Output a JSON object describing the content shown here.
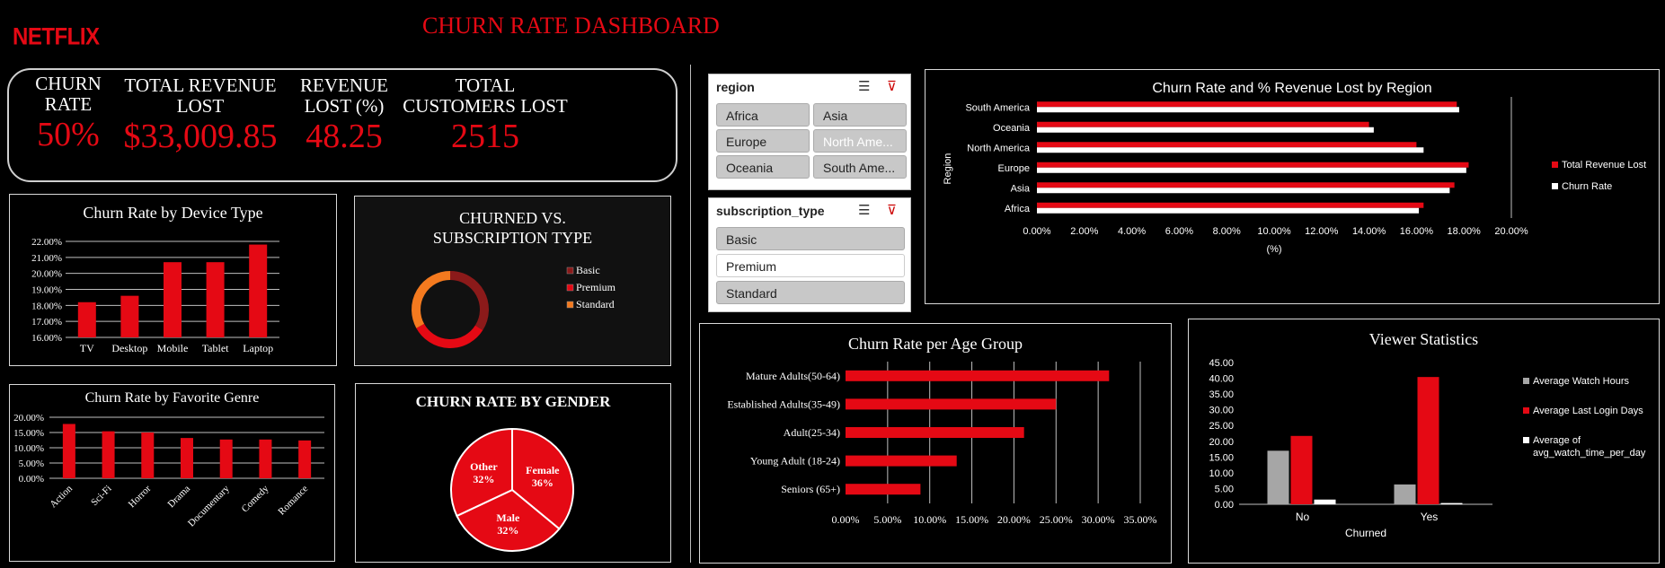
{
  "header": {
    "brand": "NETFLIX",
    "title": "CHURN RATE DASHBOARD"
  },
  "kpis": [
    {
      "label_lines": [
        "CHURN",
        "RATE"
      ],
      "value": "50%"
    },
    {
      "label_lines": [
        "TOTAL REVENUE",
        "LOST"
      ],
      "value": "$33,009.85"
    },
    {
      "label_lines": [
        "REVENUE",
        "LOST (%)"
      ],
      "value": "48.25"
    },
    {
      "label_lines": [
        "TOTAL",
        "CUSTOMERS LOST"
      ],
      "value": "2515"
    }
  ],
  "slicers": {
    "region": {
      "title": "region",
      "items": [
        "Africa",
        "Asia",
        "Europe",
        "North Ame...",
        "Oceania",
        "South Ame..."
      ]
    },
    "subscription": {
      "title": "subscription_type",
      "items": [
        "Basic",
        "Premium",
        "Standard"
      ]
    }
  },
  "colors": {
    "red": "#e50914",
    "darkred": "#8b1a1a",
    "orange": "#f47a1f",
    "gray": "#a6a6a6",
    "white": "#ffffff"
  },
  "chart_data": [
    {
      "id": "device",
      "type": "bar",
      "title": "Churn Rate by Device Type",
      "categories": [
        "TV",
        "Desktop",
        "Mobile",
        "Tablet",
        "Laptop"
      ],
      "values": [
        18.2,
        18.6,
        20.7,
        20.7,
        21.8
      ],
      "ylim": [
        16,
        22
      ],
      "yticks": [
        "16.00%",
        "17.00%",
        "18.00%",
        "19.00%",
        "20.00%",
        "21.00%",
        "22.00%"
      ]
    },
    {
      "id": "subscription",
      "type": "pie",
      "title_lines": [
        "CHURNED VS.",
        "SUBSCRIPTION TYPE"
      ],
      "categories": [
        "Basic",
        "Premium",
        "Standard"
      ],
      "values": [
        34,
        33,
        33
      ]
    },
    {
      "id": "genre",
      "type": "bar",
      "title": "Churn Rate by Favorite Genre",
      "categories": [
        "Action",
        "Sci-Fi",
        "Horror",
        "Drama",
        "Documentary",
        "Comedy",
        "Romance"
      ],
      "values": [
        17.8,
        15.4,
        15.0,
        13.2,
        12.7,
        12.7,
        12.4
      ],
      "ylim": [
        0,
        20
      ],
      "yticks": [
        "0.00%",
        "5.00%",
        "10.00%",
        "15.00%",
        "20.00%"
      ]
    },
    {
      "id": "gender",
      "type": "pie",
      "title": "CHURN RATE BY GENDER",
      "categories": [
        "Female",
        "Male",
        "Other"
      ],
      "values": [
        36,
        32,
        32
      ],
      "labels": [
        "Female\n36%",
        "Male\n32%",
        "Other\n32%"
      ]
    },
    {
      "id": "region",
      "type": "bar",
      "title": "Churn Rate and % Revenue Lost by Region",
      "categories": [
        "South America",
        "Oceania",
        "North America",
        "Europe",
        "Asia",
        "Africa"
      ],
      "series": [
        {
          "name": "Total Revenue Lost",
          "values": [
            17.7,
            14.0,
            16.0,
            18.2,
            17.6,
            16.3
          ]
        },
        {
          "name": "Churn Rate",
          "values": [
            17.8,
            14.2,
            16.3,
            18.1,
            17.4,
            16.1
          ]
        }
      ],
      "xlim": [
        0,
        20
      ],
      "xticks": [
        "0.00%",
        "2.00%",
        "4.00%",
        "6.00%",
        "8.00%",
        "10.00%",
        "12.00%",
        "14.00%",
        "16.00%",
        "18.00%",
        "20.00%"
      ],
      "xlabel": "(%)",
      "ylabel": "Region"
    },
    {
      "id": "age",
      "type": "bar",
      "title": "Churn Rate per Age Group",
      "categories": [
        "Mature Adults(50-64)",
        "Established Adults(35-49)",
        "Adult(25-34)",
        "Young Adult (18-24)",
        "Seniors (65+)"
      ],
      "values": [
        31.3,
        25.0,
        21.2,
        13.2,
        8.9
      ],
      "xlim": [
        0,
        35
      ],
      "xticks": [
        "0.00%",
        "5.00%",
        "10.00%",
        "15.00%",
        "20.00%",
        "25.00%",
        "30.00%",
        "35.00%"
      ]
    },
    {
      "id": "viewer",
      "type": "bar",
      "title": "Viewer Statistics",
      "categories": [
        "No",
        "Yes"
      ],
      "series": [
        {
          "name": "Average Watch Hours",
          "values": [
            17.0,
            6.3
          ]
        },
        {
          "name": "Average Last Login Days",
          "values": [
            21.7,
            40.4
          ]
        },
        {
          "name": "Average of avg_watch_time_per_day",
          "values": [
            1.5,
            0.4
          ]
        }
      ],
      "ylim": [
        0,
        45
      ],
      "yticks": [
        "0.00",
        "5.00",
        "10.00",
        "15.00",
        "20.00",
        "25.00",
        "30.00",
        "35.00",
        "40.00",
        "45.00"
      ],
      "xlabel": "Churned"
    }
  ]
}
